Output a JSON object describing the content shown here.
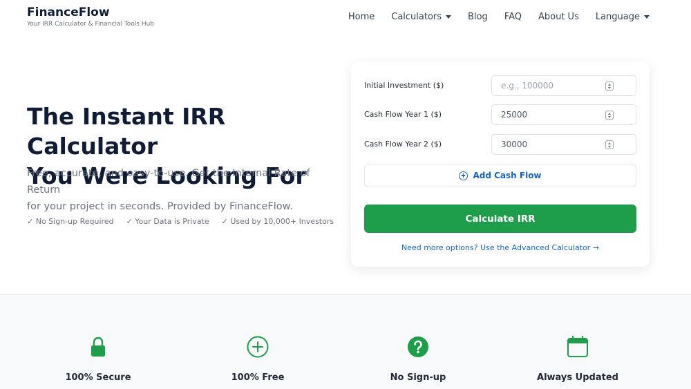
{
  "header": {
    "brand": "FinanceFlow",
    "tagline": "Your IRR Calculator & Financial Tools Hub",
    "nav": [
      {
        "label": "Home",
        "dropdown": false
      },
      {
        "label": "Calculators",
        "dropdown": true
      },
      {
        "label": "Blog",
        "dropdown": false
      },
      {
        "label": "FAQ",
        "dropdown": false
      },
      {
        "label": "About Us",
        "dropdown": false
      },
      {
        "label": "Language",
        "dropdown": true
      }
    ]
  },
  "hero": {
    "title_line1": "The Instant IRR Calculator",
    "title_line2": "You Were Looking For",
    "subtitle_line1": "Free, accurate, and easy-to-use. Get the Internal Rate of Return",
    "subtitle_line2": "for your project in seconds. Provided by FinanceFlow.",
    "checks": [
      "✓ No Sign-up Required",
      "✓ Your Data is Private",
      "✓ Used by 10,000+ Investors"
    ]
  },
  "calculator": {
    "rows": [
      {
        "label": "Initial Investment ($)",
        "value": "",
        "placeholder": "e.g., 100000"
      },
      {
        "label": "Cash Flow Year 1 ($)",
        "value": "25000",
        "placeholder": ""
      },
      {
        "label": "Cash Flow Year 2 ($)",
        "value": "30000",
        "placeholder": ""
      }
    ],
    "add_label": "Add Cash Flow",
    "calculate_label": "Calculate IRR",
    "advanced_link": "Need more options? Use the Advanced Calculator →"
  },
  "features": [
    {
      "label": "100% Secure",
      "icon": "lock-icon"
    },
    {
      "label": "100% Free",
      "icon": "plus-circle-icon"
    },
    {
      "label": "No Sign-up",
      "icon": "question-circle-icon"
    },
    {
      "label": "Always Updated",
      "icon": "calendar-icon"
    }
  ],
  "colors": {
    "accent_green": "#1e9e4a",
    "link_blue": "#1565c0",
    "heading": "#0f1c33"
  }
}
